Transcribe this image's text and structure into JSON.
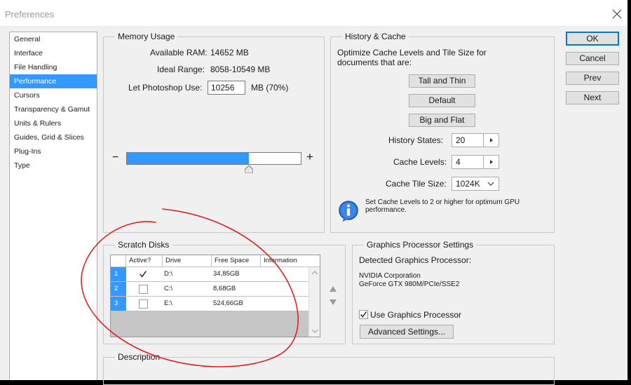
{
  "window": {
    "title": "Preferences"
  },
  "nav": {
    "items": [
      {
        "label": "General"
      },
      {
        "label": "Interface"
      },
      {
        "label": "File Handling"
      },
      {
        "label": "Performance",
        "selected": true
      },
      {
        "label": "Cursors"
      },
      {
        "label": "Transparency & Gamut"
      },
      {
        "label": "Units & Rulers"
      },
      {
        "label": "Guides, Grid & Slices"
      },
      {
        "label": "Plug-Ins"
      },
      {
        "label": "Type"
      }
    ]
  },
  "memory": {
    "title": "Memory Usage",
    "available_label": "Available RAM:",
    "available_value": "14652 MB",
    "ideal_label": "Ideal Range:",
    "ideal_value": "8058-10549 MB",
    "let_label": "Let Photoshop Use:",
    "let_value": "10256",
    "let_suffix": "MB (70%)",
    "slider_fraction": 0.7,
    "minus": "−",
    "plus": "+"
  },
  "history": {
    "title": "History & Cache",
    "desc": "Optimize Cache Levels and Tile Size for documents that are:",
    "tall_thin": "Tall and Thin",
    "default": "Default",
    "big_flat": "Big and Flat",
    "history_states_label": "History States:",
    "history_states_value": "20",
    "cache_levels_label": "Cache Levels:",
    "cache_levels_value": "4",
    "cache_tile_label": "Cache Tile Size:",
    "cache_tile_value": "1024K",
    "info_text": "Set Cache Levels to 2 or higher for optimum GPU performance."
  },
  "scratch": {
    "title": "Scratch Disks",
    "columns": [
      "Active?",
      "Drive",
      "Free Space",
      "Information"
    ],
    "rows": [
      {
        "num": "1",
        "active": true,
        "drive": "D:\\",
        "free": "34,85GB",
        "info": ""
      },
      {
        "num": "2",
        "active": false,
        "drive": "C:\\",
        "free": "8,68GB",
        "info": ""
      },
      {
        "num": "3",
        "active": false,
        "drive": "E:\\",
        "free": "524,66GB",
        "info": ""
      }
    ]
  },
  "gpu": {
    "title": "Graphics Processor Settings",
    "detected_label": "Detected Graphics Processor:",
    "vendor": "NVIDIA Corporation",
    "model": "GeForce GTX 980M/PCIe/SSE2",
    "use_label": "Use Graphics Processor",
    "use_checked": true,
    "advanced": "Advanced Settings..."
  },
  "description": {
    "title": "Description"
  },
  "buttons": {
    "ok": "OK",
    "cancel": "Cancel",
    "prev": "Prev",
    "next": "Next"
  },
  "colors": {
    "accent": "#3399ff",
    "annotation": "#e02020"
  }
}
